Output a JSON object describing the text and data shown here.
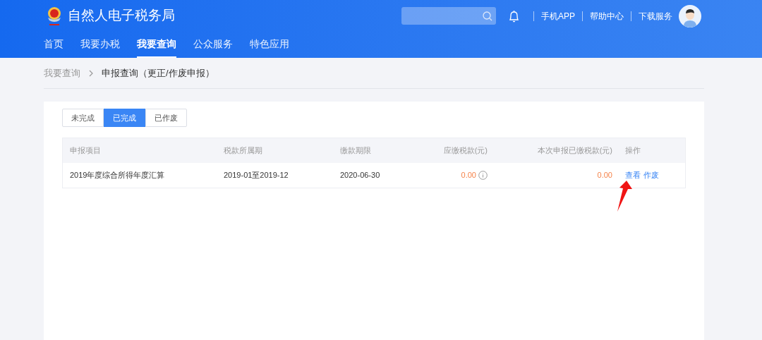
{
  "header": {
    "site_title": "自然人电子税务局",
    "top_links": [
      "手机APP",
      "帮助中心",
      "下载服务"
    ]
  },
  "nav": [
    {
      "label": "首页",
      "selected": false
    },
    {
      "label": "我要办税",
      "selected": false
    },
    {
      "label": "我要查询",
      "selected": true
    },
    {
      "label": "公众服务",
      "selected": false
    },
    {
      "label": "特色应用",
      "selected": false
    }
  ],
  "breadcrumb": [
    "我要查询",
    "申报查询（更正/作废申报）"
  ],
  "tabs": [
    {
      "label": "未完成",
      "selected": false
    },
    {
      "label": "已完成",
      "selected": true
    },
    {
      "label": "已作废",
      "selected": false
    }
  ],
  "table": {
    "columns": [
      "申报项目",
      "税款所属期",
      "缴款期限",
      "应缴税款(元)",
      "本次申报已缴税款(元)",
      "操作"
    ],
    "rows": [
      {
        "item": "2019年度综合所得年度汇算",
        "period": "2019-01至2019-12",
        "deadline": "2020-06-30",
        "tax_due": "0.00",
        "tax_paid": "0.00",
        "actions": [
          "查看",
          "作废"
        ]
      }
    ]
  }
}
